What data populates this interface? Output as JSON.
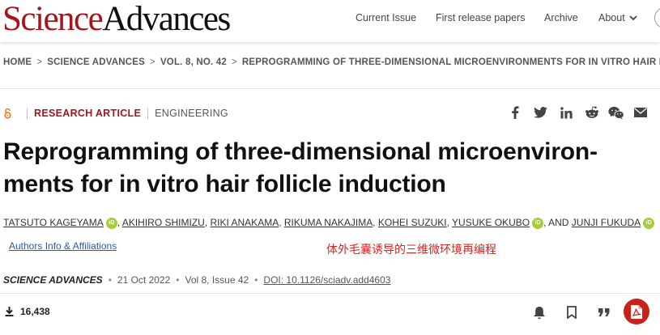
{
  "header": {
    "logo_science": "Science",
    "logo_advances": "Advances",
    "nav": [
      {
        "label": "Current Issue"
      },
      {
        "label": "First release papers"
      },
      {
        "label": "Archive"
      },
      {
        "label": "About"
      }
    ]
  },
  "breadcrumb": [
    "HOME",
    "SCIENCE ADVANCES",
    "VOL. 8, NO. 42",
    "REPROGRAMMING OF THREE-DIMENSIONAL MICROENVIRONMENTS FOR IN VITRO HAIR FOLLICLE INDUCTION"
  ],
  "article": {
    "type": "RESEARCH ARTICLE",
    "category": "ENGINEERING",
    "title_line1": "Reprogramming of three-dimensional microenviron-",
    "title_line2": "ments for in vitro hair follicle induction",
    "authors": [
      {
        "name": "TATSUTO KAGEYAMA",
        "orcid": true
      },
      {
        "name": "AKIHIRO SHIMIZU",
        "orcid": false
      },
      {
        "name": "RIKI ANAKAMA",
        "orcid": false
      },
      {
        "name": "RIKUMA NAKAJIMA",
        "orcid": false
      },
      {
        "name": "KOHEI SUZUKI",
        "orcid": false
      },
      {
        "name": "YUSUKE OKUBO",
        "orcid": true
      },
      {
        "name": "JUNJI FUKUDA",
        "orcid": true
      }
    ],
    "authors_and": "AND",
    "affiliations_link": "Authors Info & Affiliations",
    "chinese_note": "体外毛囊诱导的三维微环境再编程",
    "journal": "SCIENCE ADVANCES",
    "date": "21 Oct 2022",
    "volume_issue": "Vol 8, Issue 42",
    "doi": "DOI: 10.1126/sciadv.add4603",
    "downloads": "16,438"
  },
  "orcid_label": "iD",
  "share_icons": [
    "facebook-icon",
    "twitter-icon",
    "linkedin-icon",
    "reddit-icon",
    "wechat-icon",
    "email-icon"
  ],
  "tool_icons": [
    "bell-icon",
    "bookmark-icon",
    "quote-icon",
    "pdf-icon"
  ],
  "colors": {
    "brand_red": "#a7151c",
    "orcid_green": "#a6ce39",
    "link_blue": "#3358a6",
    "annotation_red": "#e0201a"
  }
}
